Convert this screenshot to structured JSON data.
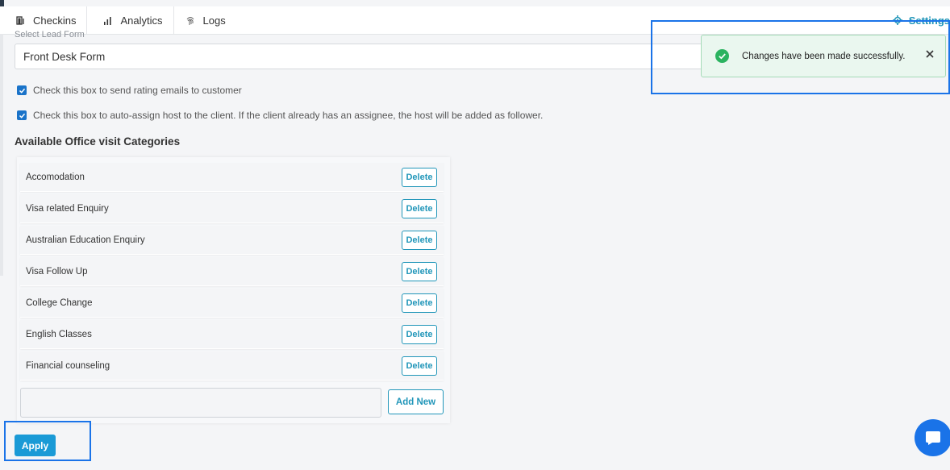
{
  "nav": {
    "tabs": [
      {
        "label": "Checkins",
        "icon": "checkin-icon"
      },
      {
        "label": "Analytics",
        "icon": "bar-chart-icon"
      },
      {
        "label": "Logs",
        "icon": "fingerprint-icon"
      }
    ],
    "settings_label": "Settings"
  },
  "form": {
    "lead_form_label": "Select Lead Form",
    "lead_form_value": "Front Desk Form",
    "checkbox_rating": "Check this box to send rating emails to customer",
    "checkbox_autoassign": "Check this box to auto-assign host to the client. If the client already has an assignee, the host will be added as follower.",
    "categories_title": "Available Office visit Categories"
  },
  "categories": [
    {
      "name": "Accomodation",
      "action": "Delete"
    },
    {
      "name": "Visa related Enquiry",
      "action": "Delete"
    },
    {
      "name": "Australian Education Enquiry",
      "action": "Delete"
    },
    {
      "name": "Visa Follow Up",
      "action": "Delete"
    },
    {
      "name": "College Change",
      "action": "Delete"
    },
    {
      "name": "English Classes",
      "action": "Delete"
    },
    {
      "name": "Financial counseling",
      "action": "Delete"
    }
  ],
  "add_new_label": "Add New",
  "apply_label": "Apply",
  "toast": {
    "message": "Changes have been made successfully.",
    "status_color": "#2bb360"
  },
  "colors": {
    "accent": "#2196b9",
    "primary_button": "#1a9ad6",
    "highlight": "#1a73e8"
  }
}
